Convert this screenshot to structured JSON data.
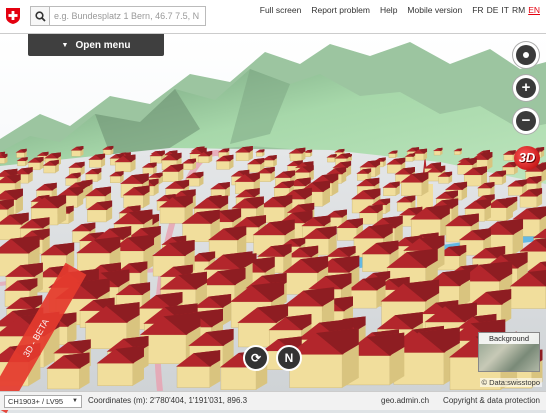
{
  "header": {
    "logo": "swiss-cross-shield",
    "search": {
      "placeholder": "e.g. Bundesplatz 1 Bern, 46.7 7.5, N",
      "value": ""
    },
    "nav": [
      "Full screen",
      "Report problem",
      "Help",
      "Mobile version"
    ],
    "languages": [
      "FR",
      "DE",
      "IT",
      "RM",
      "EN"
    ],
    "active_language": "EN"
  },
  "menu": {
    "open_label": "Open menu"
  },
  "map_controls": {
    "zoom_in": "+",
    "zoom_out": "−",
    "mode_3d": "3D"
  },
  "ribbon": {
    "text": "3D - BETA"
  },
  "background_selector": {
    "label": "Background"
  },
  "attribution": "© Data:swisstopo",
  "footer": {
    "projection": "CH1903+ / LV95",
    "coordinates": "Coordinates (m):  2'780'404, 1'191'031, 896.3",
    "links": [
      "geo.admin.ch",
      "Copyright & data protection"
    ]
  },
  "colors": {
    "brand_red": "#e4000f",
    "roof_red": "#b3262c",
    "wall": "#f1de9c",
    "terrain": "#a8d9a8"
  }
}
